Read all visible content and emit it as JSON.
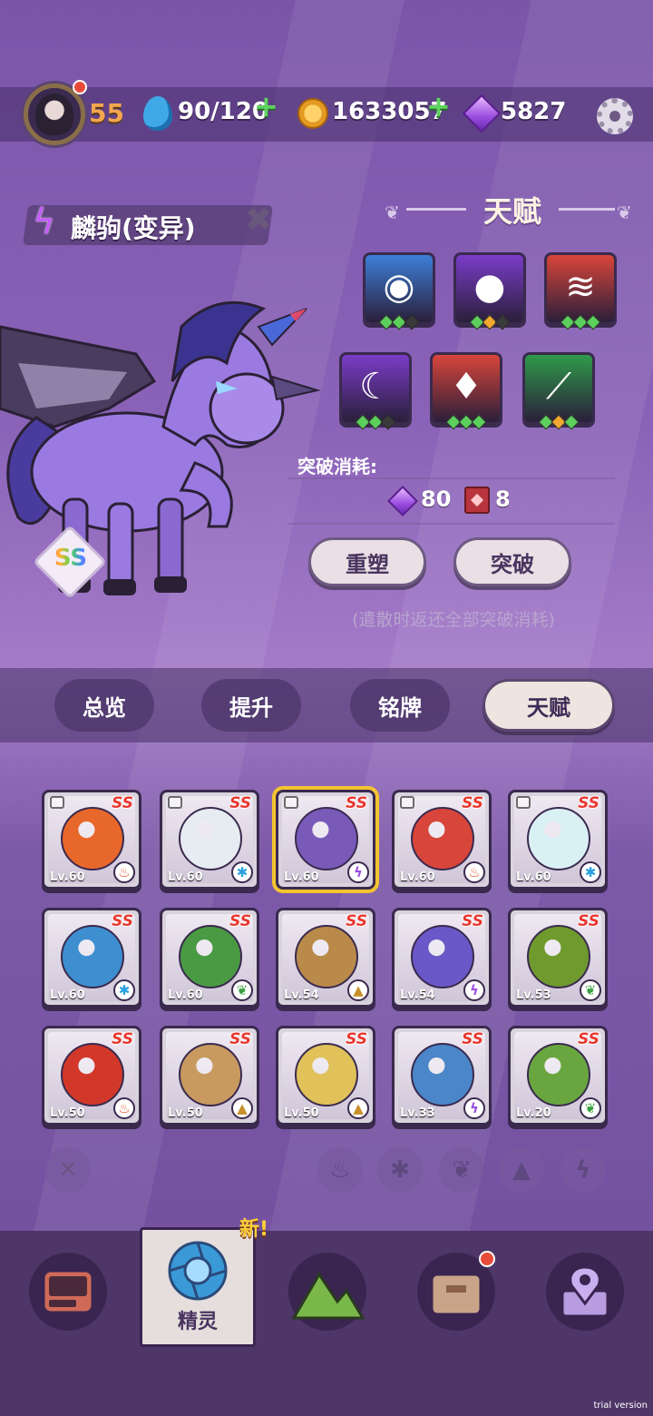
{
  "header": {
    "level": "55",
    "stamina": "90/120",
    "coins": "1633057",
    "gems": "5827"
  },
  "pet": {
    "name": "麟驹(变异)",
    "rank": "SS"
  },
  "talent": {
    "title": "天赋",
    "skills": [
      {
        "icon": "eye-icon",
        "color": "#3d7fd8",
        "pips": [
          "#5ccf5c",
          "#5ccf5c",
          "#3a3a3a"
        ]
      },
      {
        "icon": "dark-orb-icon",
        "color": "#7a3cc8",
        "pips": [
          "#5ccf5c",
          "#f2a830",
          "#3a3a3a"
        ]
      },
      {
        "icon": "fang-icon",
        "color": "#d8453a",
        "pips": [
          "#5ccf5c",
          "#5ccf5c",
          "#5ccf5c"
        ]
      },
      {
        "icon": "crescent-icon",
        "color": "#7a3cc8",
        "pips": [
          "#5ccf5c",
          "#5ccf5c",
          "#3a3a3a"
        ]
      },
      {
        "icon": "flame-drops-icon",
        "color": "#d8453a",
        "pips": [
          "#5ccf5c",
          "#5ccf5c",
          "#5ccf5c"
        ]
      },
      {
        "icon": "claw-icon",
        "color": "#2f9a4a",
        "pips": [
          "#5ccf5c",
          "#f2a830",
          "#5ccf5c"
        ]
      }
    ],
    "cost_label": "突破消耗:",
    "cost_gems": "80",
    "cost_books": "8",
    "reset_label": "重塑",
    "breakthrough_label": "突破",
    "note": "(遣散时返还全部突破消耗)"
  },
  "tabs": [
    "总览",
    "提升",
    "铭牌",
    "天赋"
  ],
  "cards": [
    {
      "level": "Lv.60",
      "rank": "SS",
      "element": "fire",
      "color": "#e8672a",
      "locked": true
    },
    {
      "level": "Lv.60",
      "rank": "SS",
      "element": "ice",
      "color": "#e6ecf2",
      "locked": true
    },
    {
      "level": "Lv.60",
      "rank": "SS",
      "element": "thunder",
      "color": "#7a5ab8",
      "locked": true
    },
    {
      "level": "Lv.60",
      "rank": "SS",
      "element": "fire",
      "color": "#d8453a",
      "locked": true
    },
    {
      "level": "Lv.60",
      "rank": "SS",
      "element": "ice",
      "color": "#d9f0f5",
      "locked": true
    },
    {
      "level": "Lv.60",
      "rank": "SS",
      "element": "ice",
      "color": "#3e8fd0",
      "locked": false
    },
    {
      "level": "Lv.60",
      "rank": "SS",
      "element": "grass",
      "color": "#4a9a44",
      "locked": false
    },
    {
      "level": "Lv.54",
      "rank": "SS",
      "element": "earth",
      "color": "#b98a4a",
      "locked": false
    },
    {
      "level": "Lv.54",
      "rank": "SS",
      "element": "thunder",
      "color": "#6a58c8",
      "locked": false
    },
    {
      "level": "Lv.53",
      "rank": "SS",
      "element": "grass",
      "color": "#6f9a2e",
      "locked": false
    },
    {
      "level": "Lv.50",
      "rank": "SS",
      "element": "fire",
      "color": "#d2382a",
      "locked": false
    },
    {
      "level": "Lv.50",
      "rank": "SS",
      "element": "earth",
      "color": "#c89a60",
      "locked": false
    },
    {
      "level": "Lv.50",
      "rank": "SS",
      "element": "earth",
      "color": "#e0c15a",
      "locked": false
    },
    {
      "level": "Lv.33",
      "rank": "SS",
      "element": "thunder",
      "color": "#4a86c8",
      "locked": false
    },
    {
      "level": "Lv.20",
      "rank": "SS",
      "element": "grass",
      "color": "#6aa640",
      "locked": false
    }
  ],
  "element_glyphs": {
    "fire": "♨",
    "ice": "✱",
    "thunder": "ϟ",
    "grass": "❦",
    "earth": "▲"
  },
  "element_colors": {
    "fire": "#e8552a",
    "ice": "#2aa0e0",
    "thunder": "#9a4ee0",
    "grass": "#3aa040",
    "earth": "#c8902a"
  },
  "filters": [
    "clear-filter-icon",
    "fire-filter-icon",
    "ice-filter-icon",
    "grass-filter-icon",
    "earth-filter-icon",
    "thunder-filter-icon"
  ],
  "nav": {
    "new_badge": "新!",
    "active_label": "精灵"
  },
  "watermark": "trial version"
}
